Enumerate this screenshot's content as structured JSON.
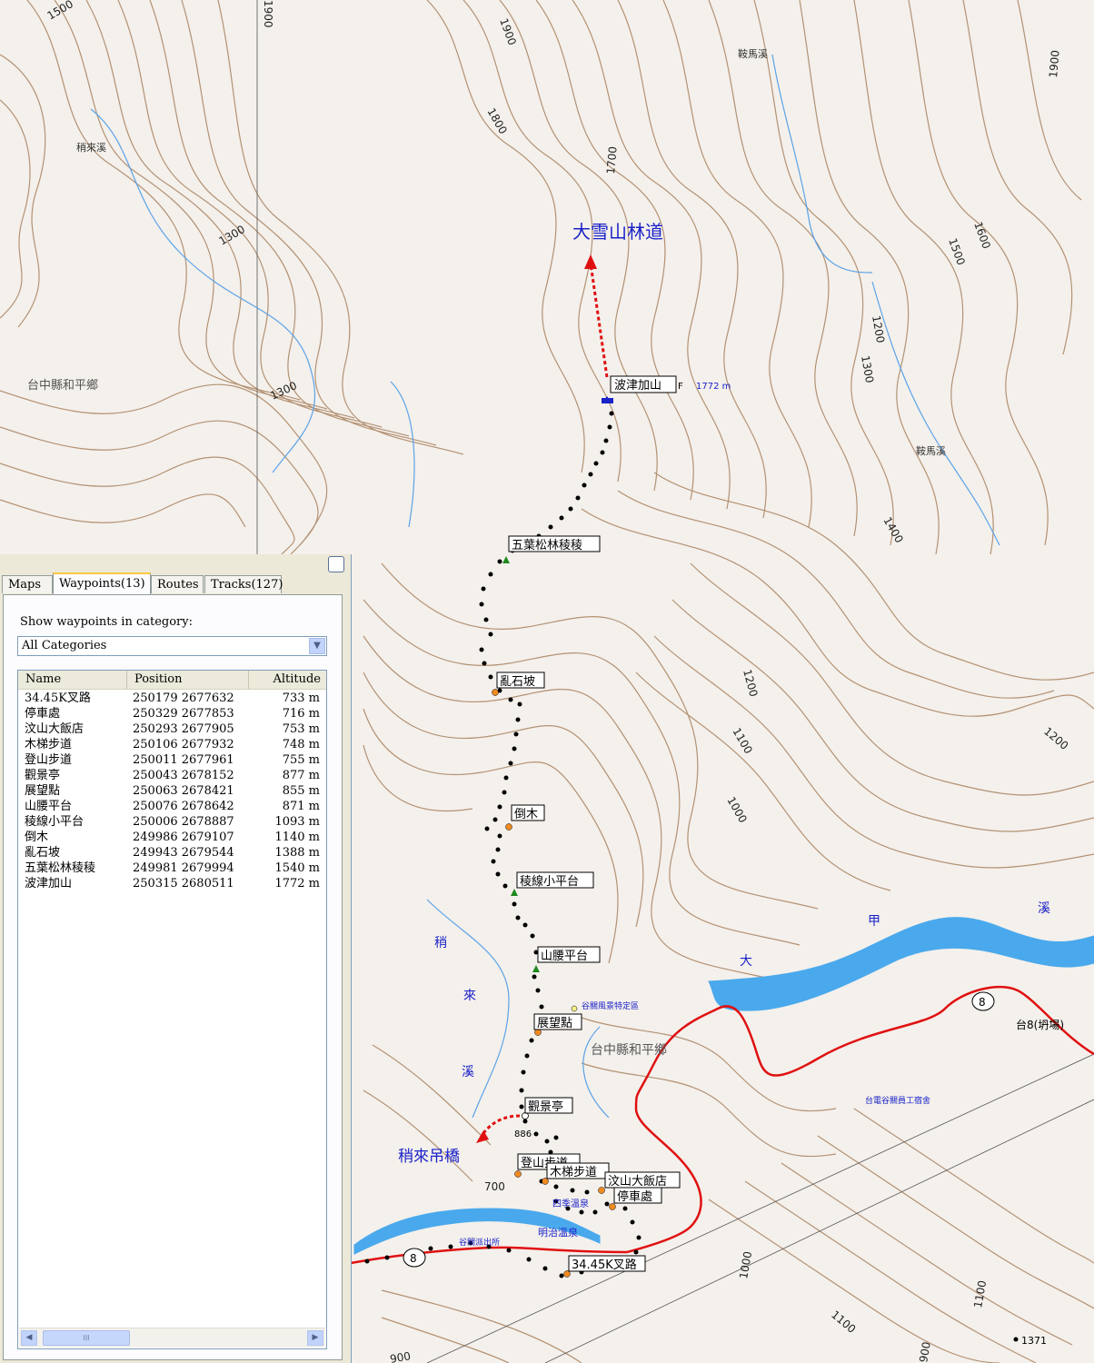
{
  "map": {
    "region_labels": [
      "台中縣和平鄉",
      "台中縣和平鄉"
    ],
    "route_label": "大雪山林道",
    "bridge_label": "稍來吊橋",
    "stream_labels": [
      "稍來溪",
      "鞍馬溪",
      "鞍馬溪"
    ],
    "river_chars": [
      "甲",
      "溪",
      "大"
    ],
    "stream_chars": [
      "稍",
      "來",
      "溪"
    ],
    "poi_labels": [
      "谷關風景特定區",
      "台電谷關員工宿舍",
      "谷關派出所",
      "四季溫泉",
      "明治溫泉"
    ],
    "road_number": "8",
    "road_label": "台8(坍場)",
    "peak_label": "1371",
    "spot_height": "886",
    "summit_alt": "1772 m",
    "summit_flag_letter": "F",
    "contour_labels": [
      "1500",
      "1900",
      "1800",
      "1700",
      "1600",
      "1500",
      "1900",
      "1300",
      "1300",
      "1200",
      "1300",
      "1400",
      "1200",
      "1100",
      "1000",
      "1200",
      "700",
      "1000",
      "1100",
      "900"
    ],
    "waypoint_labels": [
      "波津加山",
      "五葉松林稜稜",
      "亂石坡",
      "倒木",
      "稜線小平台",
      "山腰平台",
      "展望點",
      "觀景亭",
      "登山步道",
      "木梯步道",
      "汶山大飯店",
      "停車處",
      "34.45K叉路"
    ],
    "colors": {
      "background": "#f4f0ec",
      "contour": "#a8825e",
      "stream": "#5aa3e8",
      "river": "#4aa9ec",
      "road": "#e01010",
      "track": "#000000",
      "annotation_blue": "#1a22c8"
    }
  },
  "panel": {
    "tabs": [
      {
        "label": "Maps"
      },
      {
        "label": "Waypoints(13)"
      },
      {
        "label": "Routes"
      },
      {
        "label": "Tracks(127)"
      }
    ],
    "active_tab": "Waypoints(13)",
    "category_label": "Show waypoints in category:",
    "category_value": "All Categories",
    "columns": [
      "Name",
      "Position",
      "Altitude"
    ],
    "waypoints": [
      {
        "name": "34.45K叉路",
        "position": "250179 2677632",
        "altitude": "733 m"
      },
      {
        "name": "停車處",
        "position": "250329 2677853",
        "altitude": "716 m"
      },
      {
        "name": "汶山大飯店",
        "position": "250293 2677905",
        "altitude": "753 m"
      },
      {
        "name": "木梯步道",
        "position": "250106 2677932",
        "altitude": "748 m"
      },
      {
        "name": "登山步道",
        "position": "250011 2677961",
        "altitude": "755 m"
      },
      {
        "name": "觀景亭",
        "position": "250043 2678152",
        "altitude": "877 m"
      },
      {
        "name": "展望點",
        "position": "250063 2678421",
        "altitude": "855 m"
      },
      {
        "name": "山腰平台",
        "position": "250076 2678642",
        "altitude": "871 m"
      },
      {
        "name": "稜線小平台",
        "position": "250006 2678887",
        "altitude": "1093 m"
      },
      {
        "name": "倒木",
        "position": "249986 2679107",
        "altitude": "1140 m"
      },
      {
        "name": "亂石坡",
        "position": "249943 2679544",
        "altitude": "1388 m"
      },
      {
        "name": "五葉松林稜稜",
        "position": "249981 2679994",
        "altitude": "1540 m"
      },
      {
        "name": "波津加山",
        "position": "250315 2680511",
        "altitude": "1772 m"
      }
    ],
    "scroll_grip": "III"
  }
}
